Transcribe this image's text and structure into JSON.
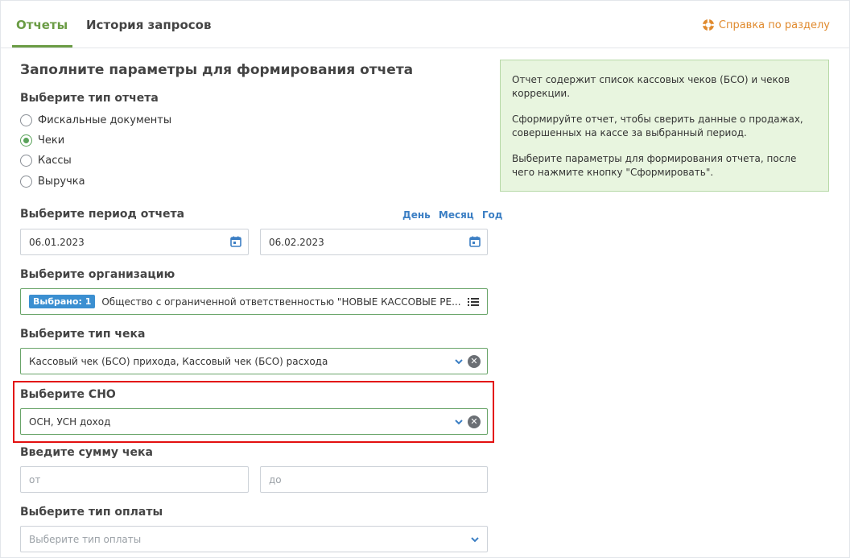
{
  "tabs": [
    {
      "label": "Отчеты",
      "active": true
    },
    {
      "label": "История запросов",
      "active": false
    }
  ],
  "help": {
    "label": "Справка по разделу",
    "icon": "lifebuoy-icon",
    "color": "#e08a2e"
  },
  "form": {
    "heading": "Заполните параметры для формирования отчета",
    "report_type": {
      "label": "Выберите тип отчета",
      "options": [
        "Фискальные документы",
        "Чеки",
        "Кассы",
        "Выручка"
      ],
      "selected": "Чеки"
    },
    "period": {
      "label": "Выберите период отчета",
      "links": [
        "День",
        "Месяц",
        "Год"
      ],
      "from": "06.01.2023",
      "to": "06.02.2023"
    },
    "organization": {
      "label": "Выберите организацию",
      "badge": "Выбрано: 1",
      "value": "Общество с ограниченной ответственностью \"НОВЫЕ КАССОВЫЕ РЕ..."
    },
    "check_type": {
      "label": "Выберите тип чека",
      "value": "Кассовый чек (БСО) прихода, Кассовый чек (БСО) расхода"
    },
    "sno": {
      "label": "Выберите СНО",
      "value": "ОСН, УСН доход"
    },
    "amount": {
      "label": "Введите сумму чека",
      "from_placeholder": "от",
      "to_placeholder": "до"
    },
    "payment_type": {
      "label": "Выберите тип оплаты",
      "placeholder": "Выберите тип оплаты"
    }
  },
  "info": {
    "paragraphs": [
      "Отчет содержит список кассовых чеков (БСО) и чеков коррекции.",
      "Сформируйте отчет, чтобы сверить данные о продажах, совершенных на кассе за выбранный период.",
      "Выберите параметры для формирования отчета, после чего нажмите кнопку \"Сформировать\"."
    ]
  },
  "colors": {
    "accent_green": "#6b9c45",
    "link_blue": "#3c7fc4",
    "highlight_red": "#e31010",
    "info_bg": "#e8f5df"
  }
}
